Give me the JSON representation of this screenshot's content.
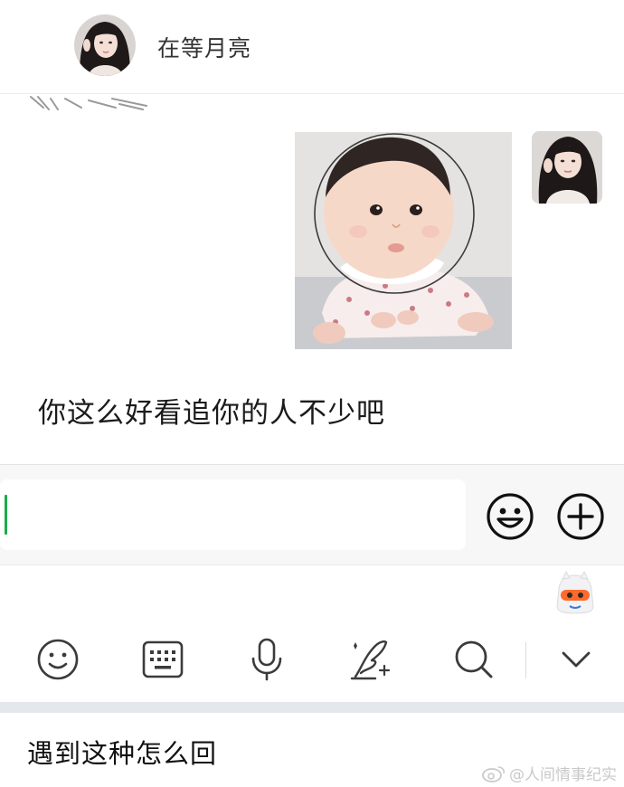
{
  "header": {
    "contact_name": "在等月亮"
  },
  "chat": {
    "messages": [
      {
        "type": "image",
        "from": "me",
        "content": "baby-photo"
      },
      {
        "type": "text",
        "from": "contact",
        "text": "你这么好看追你的人不少吧"
      }
    ]
  },
  "input_bar": {
    "text_value": "",
    "emoji_button": "smiley-icon",
    "more_button": "plus-circle-icon"
  },
  "keyboard_toolbar": {
    "items": [
      "smiley-icon",
      "keyboard-icon",
      "microphone-icon",
      "handwriting-icon",
      "search-icon",
      "chevron-down-icon"
    ],
    "accent_color": "#1aad4a"
  },
  "caption": {
    "text": "遇到这种怎么回"
  },
  "watermark": {
    "text": "人间情事纪实"
  }
}
